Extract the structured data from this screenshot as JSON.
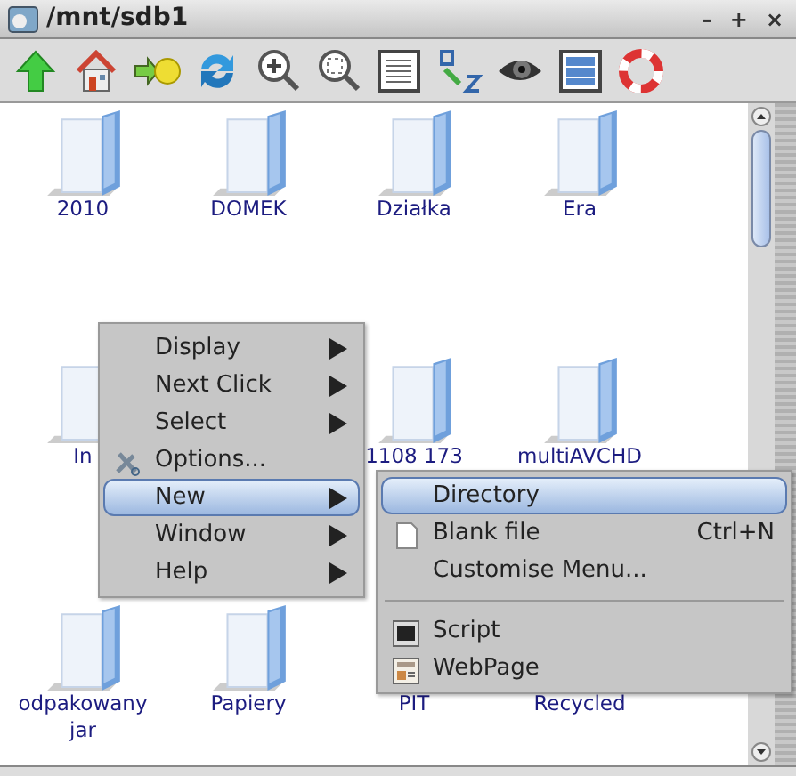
{
  "window": {
    "title": "/mnt/sdb1",
    "controls": [
      "–",
      "+",
      "×"
    ]
  },
  "files": [
    [
      {
        "label": "2010",
        "kind": "folder"
      },
      {
        "label": "DOMEK",
        "kind": "folder"
      },
      {
        "label": "Działka",
        "kind": "folder"
      },
      {
        "label": "Era",
        "kind": "folder"
      }
    ],
    [
      {
        "label": "In",
        "kind": "folder"
      },
      {
        "kind": "covered"
      },
      {
        "label": "1108 173",
        "kind": "folder"
      },
      {
        "label": "multiAVCHD",
        "kind": "folder"
      }
    ],
    [
      {
        "label": "odpakowany jar",
        "kind": "folder"
      },
      {
        "label": "Papiery",
        "kind": "folder"
      },
      {
        "label": "PIT",
        "kind": "label"
      },
      {
        "label": "Recycled",
        "kind": "label"
      }
    ]
  ],
  "context_menu": {
    "items": [
      {
        "label": "Display",
        "kind": "submenu",
        "selected": false
      },
      {
        "label": "Next Click",
        "kind": "submenu",
        "selected": false
      },
      {
        "label": "Select",
        "kind": "submenu",
        "selected": false
      },
      {
        "label": "Options...",
        "kind": "tools",
        "selected": false
      },
      {
        "label": "New",
        "kind": "submenu",
        "selected": true
      },
      {
        "label": "Window",
        "kind": "submenu",
        "selected": false
      },
      {
        "label": "Help",
        "kind": "submenu",
        "selected": false
      }
    ]
  },
  "submenu": {
    "items": [
      {
        "label": "Directory",
        "kind": "plain",
        "selected": true
      },
      {
        "label": "Blank file",
        "kind": "file",
        "shortcut": "Ctrl+N",
        "selected": false
      },
      {
        "label": "Customise Menu...",
        "kind": "plain",
        "selected": false
      },
      {
        "kind": "separator"
      },
      {
        "label": "Script",
        "kind": "terminal",
        "selected": false
      },
      {
        "label": "WebPage",
        "kind": "web",
        "selected": false
      }
    ]
  }
}
